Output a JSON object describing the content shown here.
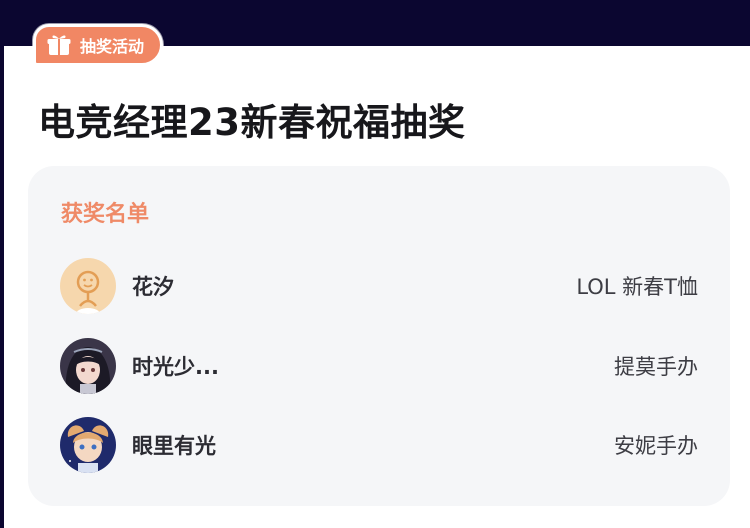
{
  "badge": {
    "label": "抽奖活动",
    "icon": "gift-icon",
    "color": "#f18764"
  },
  "title": "电竞经理23新春祝福抽奖",
  "winners": {
    "heading": "获奖名单",
    "items": [
      {
        "name": "花汐",
        "prize": "LOL 新春T恤",
        "avatar": "default-avatar"
      },
      {
        "name": "时光少...",
        "prize": "提莫手办",
        "avatar": "anime-girl-avatar"
      },
      {
        "name": "眼里有光",
        "prize": "安妮手办",
        "avatar": "anime-character-avatar"
      }
    ]
  },
  "colors": {
    "accent": "#ef8a67",
    "background_top": "#0b0630",
    "panel": "#f5f6f8"
  }
}
